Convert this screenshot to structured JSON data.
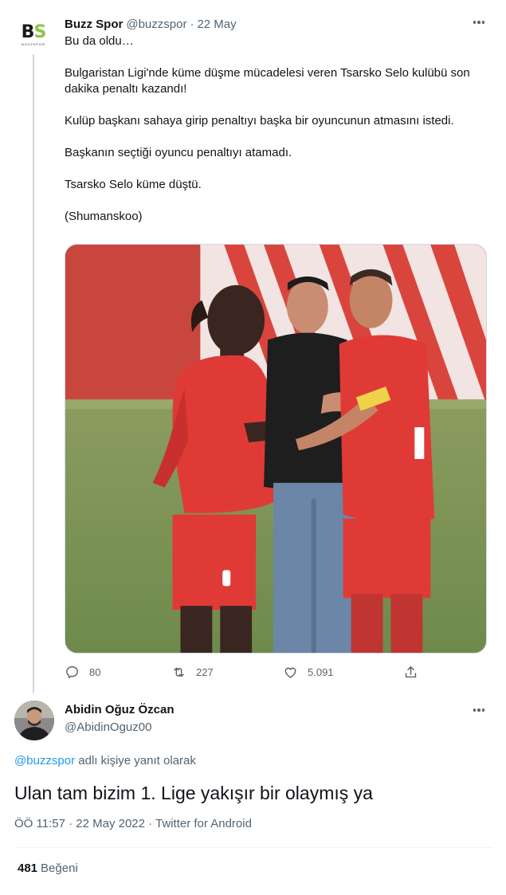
{
  "tweet": {
    "display_name": "Buzz Spor",
    "handle": "@buzzspor",
    "separator": "·",
    "date": "22 May",
    "avatar_icon": "buzz-spor-logo-icon",
    "avatar_logo_text": [
      "B",
      "S",
      "BUZZSPOR"
    ],
    "paragraphs": [
      "Bu da oldu…",
      "Bulgaristan Ligi'nde küme düşme mücadelesi veren Tsarsko Selo kulübü son dakika penaltı kazandı!",
      "Kulüp başkanı sahaya girip penaltıyı başka bir oyuncunun atmasını istedi.",
      "Başkanın seçtiği oyuncu penaltıyı atamadı.",
      "Tsarsko Selo küme düştü.",
      "(Shumanskoo)"
    ],
    "media_description_icon": "football-players-photo",
    "actions": {
      "reply_count": "80",
      "retweet_count": "227",
      "like_count": "5.091"
    }
  },
  "reply": {
    "display_name": "Abidin Oğuz Özcan",
    "handle": "@AbidinOguz00",
    "reply_mention": "@buzzspor",
    "reply_suffix": "adlı kişiye yanıt olarak",
    "text": "Ulan tam bizim 1. Lige yakışır bir olaymış ya",
    "timestamp": "ÖÖ 11:57 · 22 May 2022 · Twitter for Android",
    "likes_count": "481",
    "likes_label": "Beğeni"
  },
  "colors": {
    "text_primary": "#0f1419",
    "text_secondary": "#536471",
    "link_blue": "#1d9bf0",
    "divider": "#eff3f4",
    "jersey_red": "#e03a36"
  }
}
